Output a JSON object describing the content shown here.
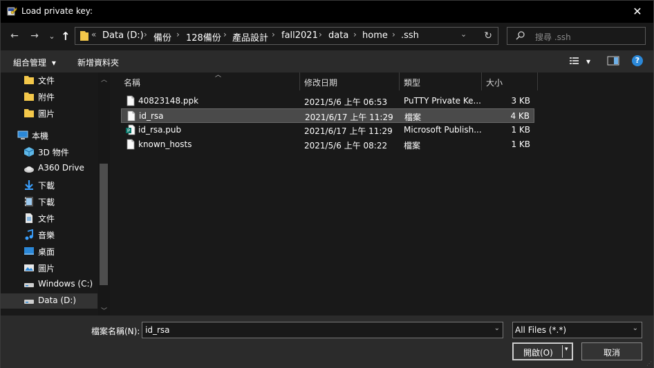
{
  "window": {
    "title": "Load private key:",
    "close_glyph": "✕"
  },
  "nav": {
    "back_glyph": "←",
    "forward_glyph": "→",
    "recent_glyph": "⌄",
    "up_glyph": "↑",
    "overflow": "«",
    "breadcrumbs": [
      "Data (D:)",
      "備份",
      "128備份",
      "產品設計",
      "fall2021",
      "data",
      "home",
      ".ssh"
    ],
    "sep_glyph": "›",
    "history_glyph": "⌄",
    "refresh_glyph": "↻",
    "search_placeholder": "搜尋 .ssh"
  },
  "commands": {
    "organize": "組合管理",
    "organize_arrow": "▾",
    "new_folder": "新增資料夾",
    "view_arrow": "▾",
    "help": "?"
  },
  "tree": [
    {
      "label": "文件",
      "icon": "folder-icon",
      "indent": 1
    },
    {
      "label": "附件",
      "icon": "folder-icon",
      "indent": 1
    },
    {
      "label": "圖片",
      "icon": "folder-icon",
      "indent": 1
    },
    {
      "label": "本機",
      "icon": "computer-icon",
      "indent": 0
    },
    {
      "label": "3D 物件",
      "icon": "cube-icon",
      "indent": 1
    },
    {
      "label": "A360 Drive",
      "icon": "cloud-drive-icon",
      "indent": 1
    },
    {
      "label": "下載",
      "icon": "download-icon",
      "indent": 1
    },
    {
      "label": "下載",
      "icon": "film-icon",
      "indent": 1
    },
    {
      "label": "文件",
      "icon": "document-icon",
      "indent": 1
    },
    {
      "label": "音樂",
      "icon": "music-icon",
      "indent": 1
    },
    {
      "label": "桌面",
      "icon": "desktop-icon",
      "indent": 1
    },
    {
      "label": "圖片",
      "icon": "pictures-icon",
      "indent": 1
    },
    {
      "label": "Windows (C:)",
      "icon": "drive-icon",
      "indent": 1
    },
    {
      "label": "Data (D:)",
      "icon": "drive-icon",
      "indent": 1,
      "selected": true
    }
  ],
  "columns": {
    "name": "名稱",
    "modified": "修改日期",
    "type": "類型",
    "size": "大小"
  },
  "files": [
    {
      "name": "40823148.ppk",
      "modified": "2021/5/6 上午 06:53",
      "type": "PuTTY Private Ke...",
      "size": "3 KB",
      "icon": "file-icon"
    },
    {
      "name": "id_rsa",
      "modified": "2021/6/17 上午 11:29",
      "type": "檔案",
      "size": "4 KB",
      "icon": "file-icon",
      "selected": true
    },
    {
      "name": "id_rsa.pub",
      "modified": "2021/6/17 上午 11:29",
      "type": "Microsoft Publish...",
      "size": "1 KB",
      "icon": "publisher-file-icon"
    },
    {
      "name": "known_hosts",
      "modified": "2021/5/6 上午 08:22",
      "type": "檔案",
      "size": "1 KB",
      "icon": "file-icon"
    }
  ],
  "bottom": {
    "filename_label": "檔案名稱(N):",
    "filename_value": "id_rsa",
    "filter_value": "All Files (*.*)",
    "dropdown_glyph": "⌄",
    "open_label": "開啟(O)",
    "open_arrow": "▾",
    "cancel_label": "取消"
  },
  "colors": {
    "background": "#191919",
    "titlebar": "#000000",
    "toolbar": "#2b2b2b",
    "selection": "#4a4a4a",
    "folder": "#f4c84a",
    "accent_blue": "#2b88d8"
  }
}
